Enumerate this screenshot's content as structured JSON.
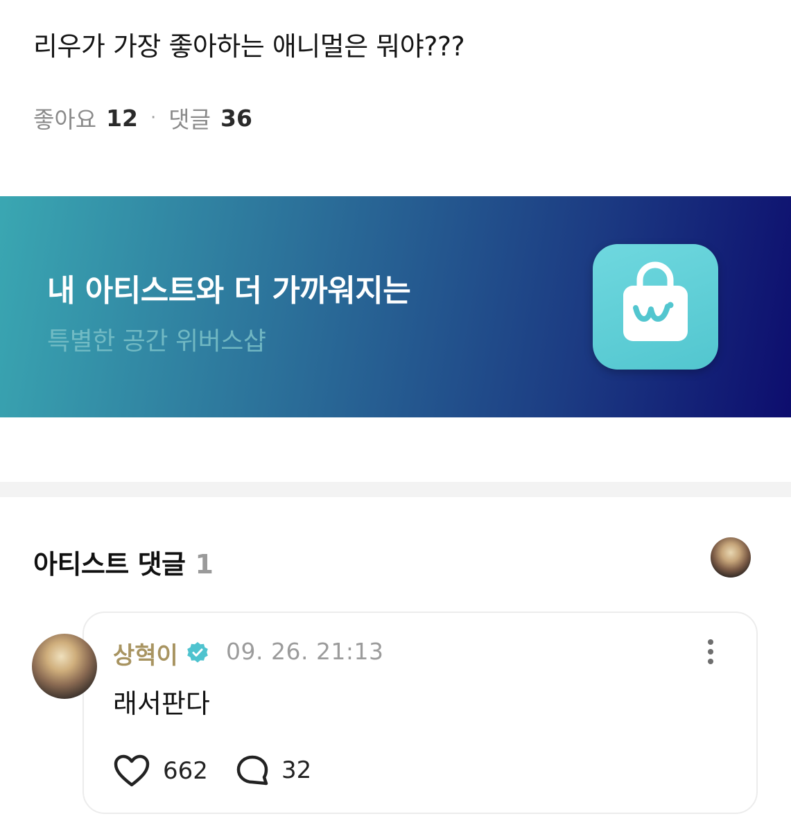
{
  "post": {
    "text": "리우가 가장 좋아하는 애니멀은 뭐야???",
    "likes_label": "좋아요",
    "likes_count": "12",
    "separator": "·",
    "comments_label": "댓글",
    "comments_count": "36"
  },
  "banner": {
    "title": "내 아티스트와 더 가까워지는",
    "subtitle": "특별한 공간 위버스샵",
    "icon": "weverse-shop-bag-icon",
    "colors": {
      "gradient_start": "#3aa7b2",
      "gradient_end": "#0d0d6e",
      "icon_bg": "#5fcfd7"
    }
  },
  "artist_comments": {
    "title": "아티스트 댓글",
    "count": "1"
  },
  "comment": {
    "author": "상혁이",
    "verified": true,
    "timestamp": "09. 26. 21:13",
    "body": "래서판다",
    "likes": "662",
    "replies": "32",
    "author_color": "#a89461",
    "verified_color": "#4fc3cf"
  }
}
